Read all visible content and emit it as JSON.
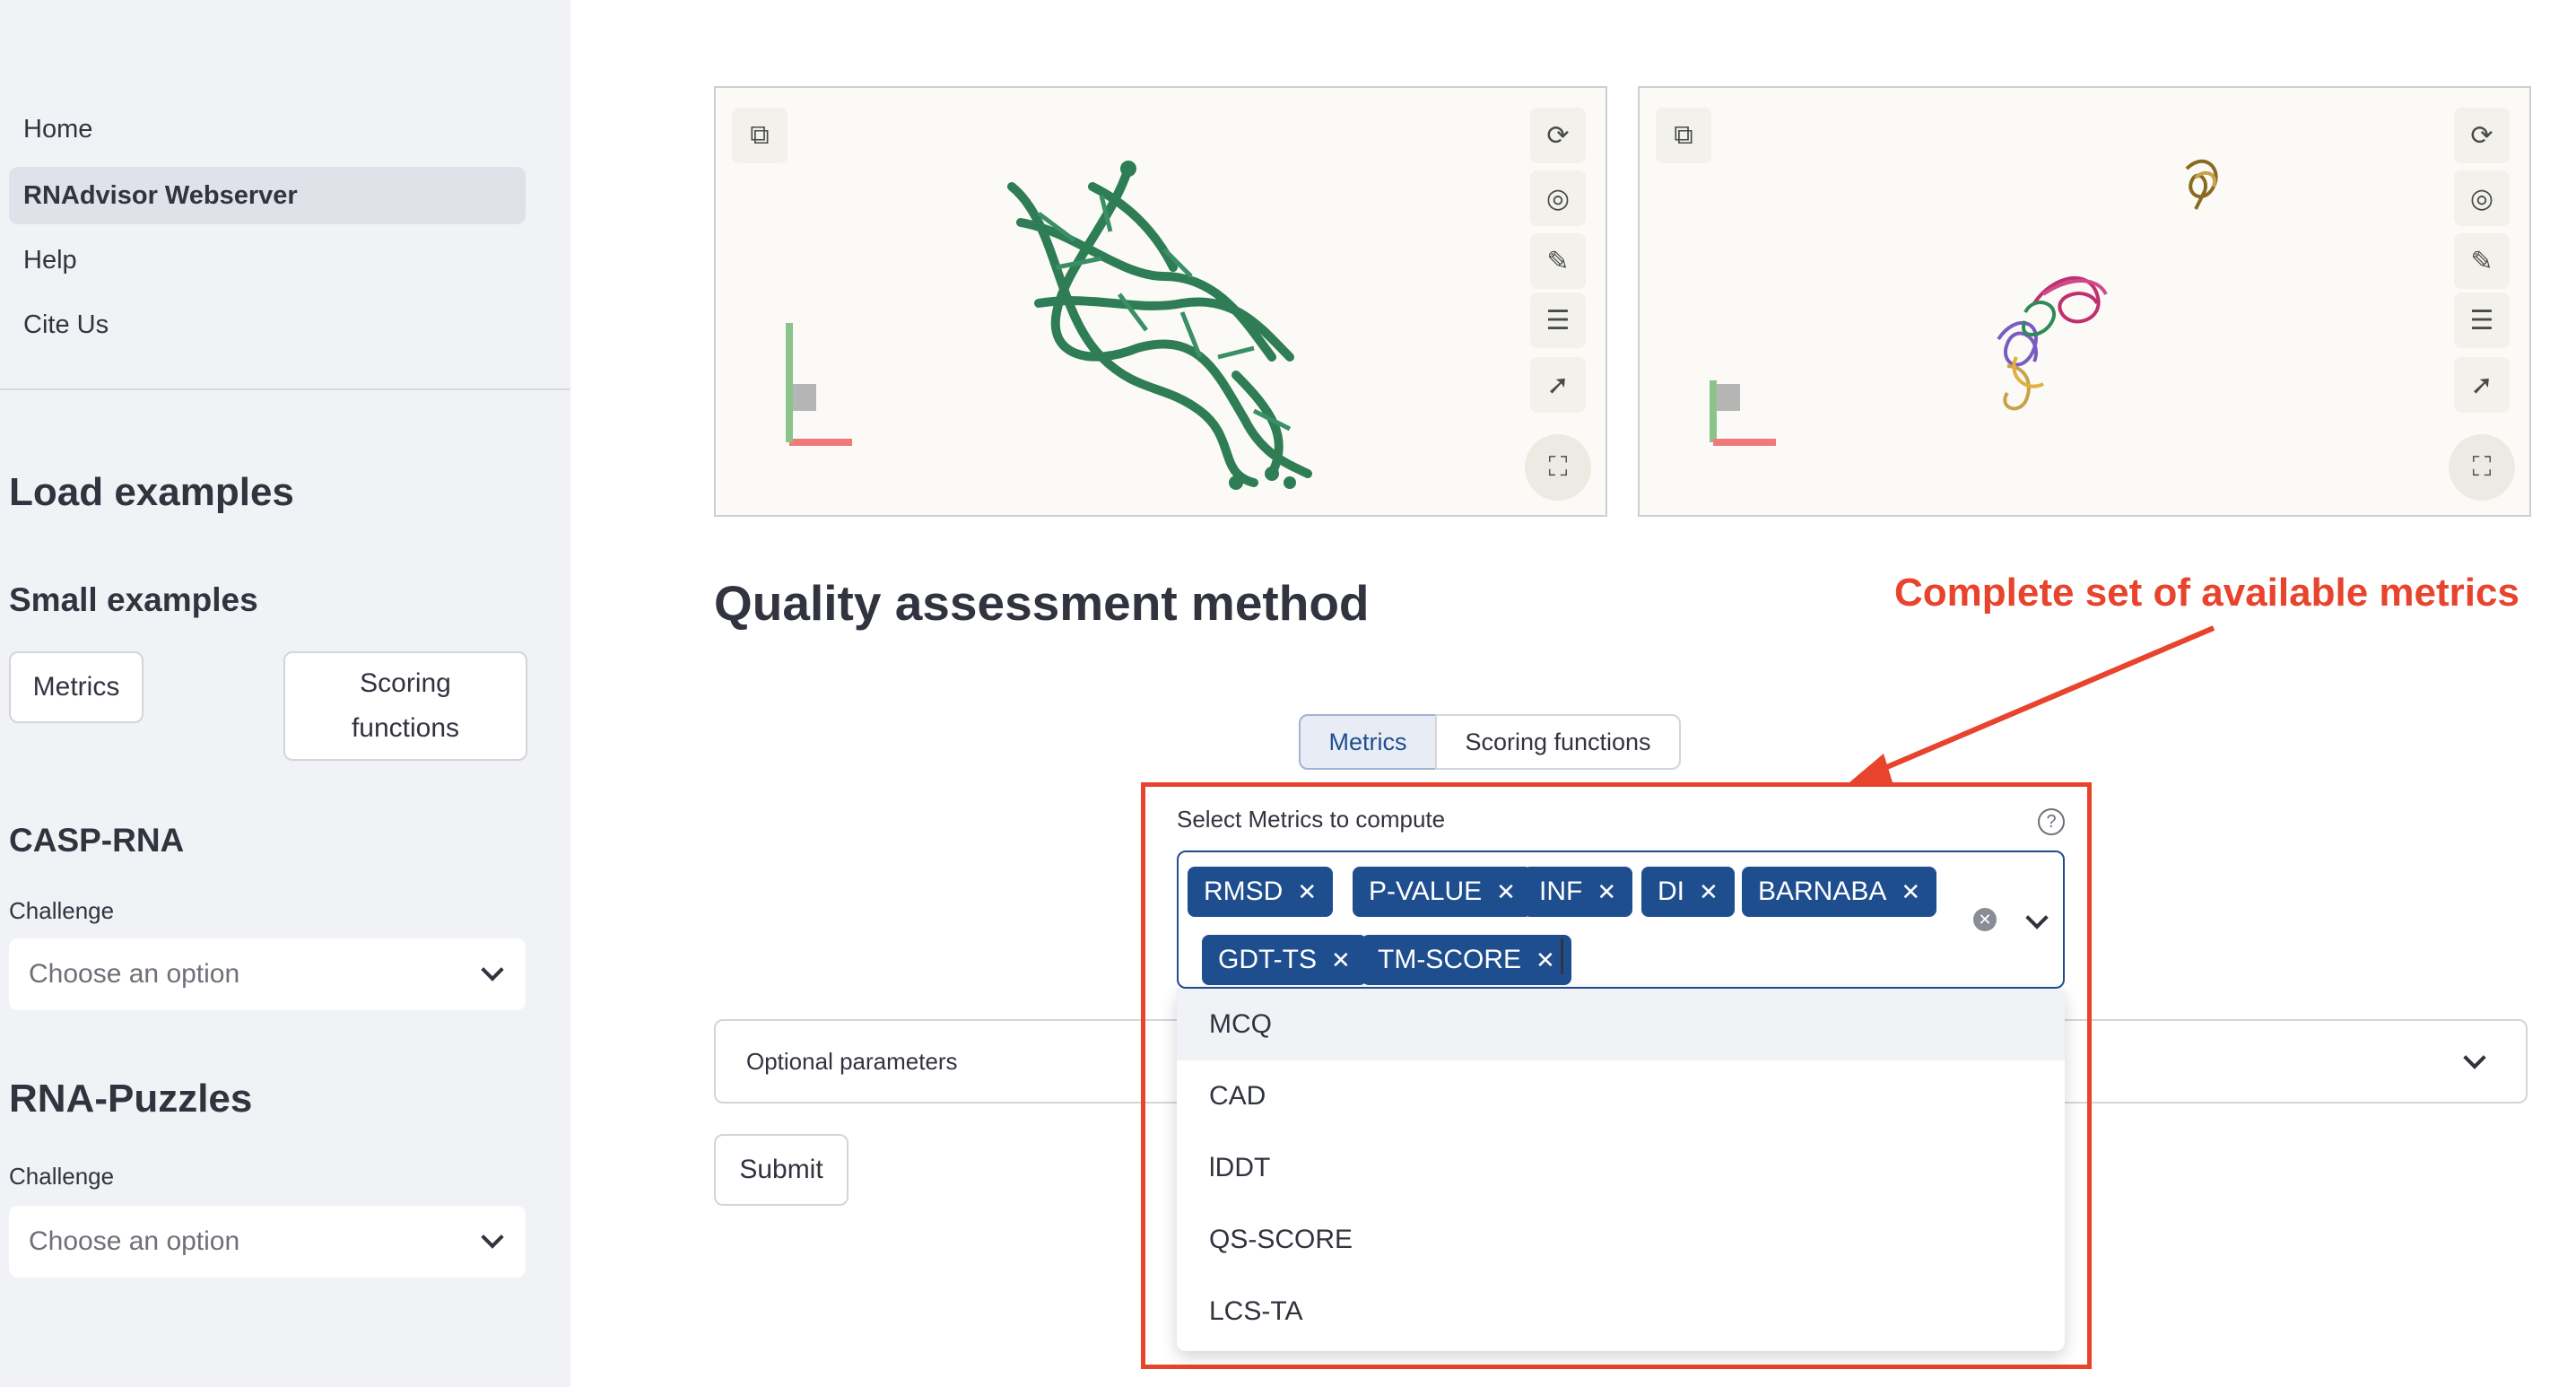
{
  "sidebar": {
    "nav": [
      "Home",
      "RNAdvisor Webserver",
      "Help",
      "Cite Us"
    ],
    "active_nav": "RNAdvisor Webserver",
    "load_examples_title": "Load examples",
    "small_examples_title": "Small examples",
    "small_buttons": [
      "Metrics",
      "Scoring functions"
    ],
    "casp_title": "CASP-RNA",
    "casp_challenge_label": "Challenge",
    "casp_placeholder": "Choose an option",
    "puzzles_title": "RNA-Puzzles",
    "puzzles_challenge_label": "Challenge",
    "puzzles_placeholder": "Choose an option"
  },
  "main": {
    "title": "Quality assessment method",
    "annotation": "Complete set of available metrics",
    "tabs": [
      "Metrics",
      "Scoring functions"
    ],
    "active_tab": "Metrics",
    "multiselect_label": "Select Metrics to compute",
    "selected_metrics": [
      "RMSD",
      "P-VALUE",
      "INF",
      "DI",
      "BARNABA",
      "GDT-TS",
      "TM-SCORE"
    ],
    "dropdown_options": [
      "MCQ",
      "CAD",
      "lDDT",
      "QS-SCORE",
      "LCS-TA"
    ],
    "optional_parameters_label": "Optional parameters",
    "submit_label": "Submit"
  },
  "colors": {
    "accent": "#1f4e8f",
    "annotation": "#e8432c",
    "sidebar_bg": "#f0f2f6",
    "rna_left": "#2e7d55",
    "rna_right_a": "#c8a24a",
    "rna_right_b": "#c0306f"
  },
  "icons": [
    "rotate-icon",
    "camera-icon",
    "wrench-icon",
    "sliders-icon",
    "pointer-icon",
    "fullscreen-icon",
    "help-icon",
    "chevron-down-icon",
    "clear-icon",
    "animation-icon"
  ]
}
